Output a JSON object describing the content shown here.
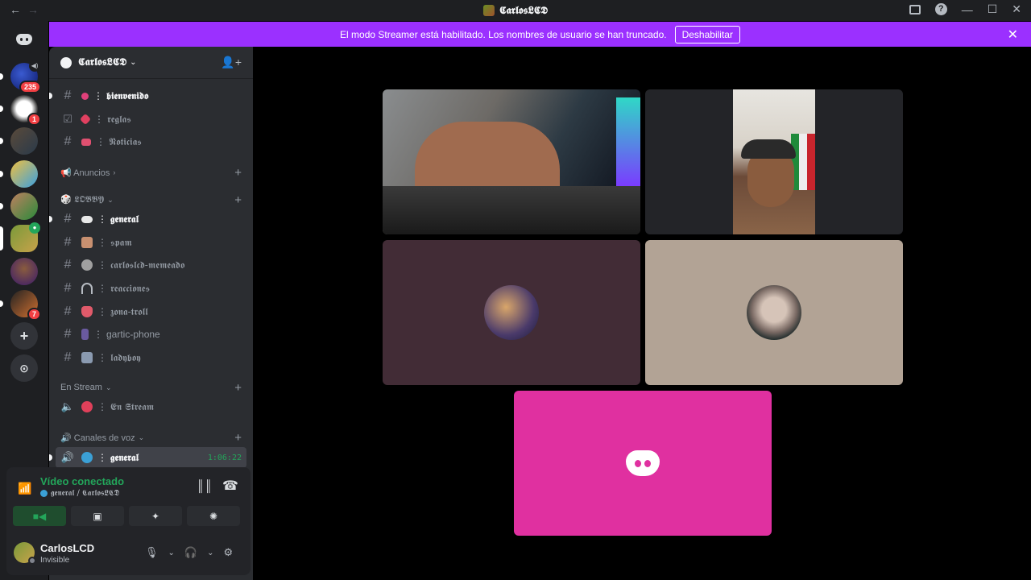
{
  "titlebar": {
    "back": "←",
    "forward": "→",
    "title": "𝕮𝖆𝖗𝖑𝖔𝖘𝕷𝕮𝕯",
    "minimize": "—",
    "maximize": "☐",
    "close": "✕"
  },
  "rail": {
    "badges": [
      "235",
      "1",
      "7"
    ],
    "add_server": "+",
    "discover": "⊙"
  },
  "banner": {
    "message": "El modo Streamer está habilitado. Los nombres de usuario se han truncado.",
    "button": "Deshabilitar",
    "close": "✕"
  },
  "guild": {
    "name": "𝕮𝖆𝖗𝖑𝖔𝖘𝕷𝕮𝕯",
    "chevron": "⌄",
    "invite_icon": "👤+"
  },
  "channels": [
    {
      "name": "𝖇𝖎𝖊𝖓𝖛𝖊𝖓𝖎𝖉𝖔",
      "icon": "#",
      "unread": true
    },
    {
      "name": "𝖗𝖊𝖌𝖑𝖆𝖘",
      "icon": "☑",
      "unread": false
    },
    {
      "name": "𝕹𝖔𝖙𝖎𝖈𝖎𝖆𝖘",
      "icon": "#",
      "unread": false
    }
  ],
  "categories": {
    "anuncios": "📢 Anuncios",
    "lobby": "🎲 𝕷𝕺𝕭𝕭𝖄",
    "en_stream": "En Stream",
    "canales_voz": "🔊 Canales de voz"
  },
  "lobby_channels": [
    {
      "name": "𝖌𝖊𝖓𝖊𝖗𝖆𝖑",
      "unread": true
    },
    {
      "name": "𝖘𝖕𝖆𝖒",
      "unread": false
    },
    {
      "name": "𝖈𝖆𝖗𝖑𝖔𝖘𝖑𝖈𝖉-𝖒𝖊𝖒𝖊𝖆𝖉𝖔",
      "unread": false
    },
    {
      "name": "𝖗𝖊𝖆𝖈𝖈𝖎𝖔𝖓𝖊𝖘",
      "unread": false
    },
    {
      "name": "𝖟𝖔𝖓𝖆-𝖙𝖗𝖔𝖑𝖑",
      "unread": false
    },
    {
      "name": "gartic-phone",
      "unread": false
    },
    {
      "name": "𝖑𝖆𝖉𝖞𝖇𝖔𝖞",
      "unread": false
    }
  ],
  "stream_channel": {
    "name": "𝕰𝖓 𝕾𝖙𝖗𝖊𝖆𝖒"
  },
  "voice_channel": {
    "name": "𝖌𝖊𝖓𝖊𝖗𝖆𝖑",
    "timer": "1:06:22"
  },
  "voice_panel": {
    "title": "Vídeo conectado",
    "subtitle": "𝖌𝖊𝖓𝖊𝖗𝖆𝖑 / 𝕮𝖆𝖗𝖑𝖔𝖘𝕷𝕮𝕯"
  },
  "user": {
    "name": "CarlosLCD",
    "status": "Invisible"
  },
  "colors": {
    "banner": "#9b30ff",
    "connected": "#23a55a",
    "tile_discord": "#e030a0"
  }
}
